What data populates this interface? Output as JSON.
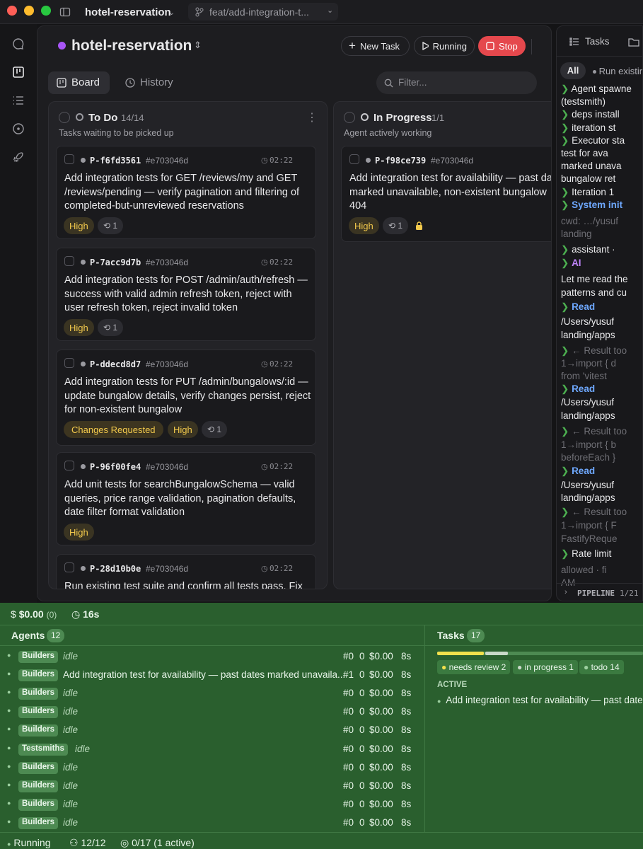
{
  "titlebar": {
    "project": "hotel-reservation",
    "branch": "feat/add-integration-t..."
  },
  "header": {
    "project_name": "hotel-reservation",
    "new_task": "New Task",
    "running": "Running",
    "stop": "Stop"
  },
  "tabs": {
    "board": "Board",
    "history": "History"
  },
  "filter": {
    "placeholder": "Filter..."
  },
  "columns": {
    "todo": {
      "title": "To Do",
      "count": "14/14",
      "subtitle": "Tasks waiting to be picked up"
    },
    "inprogress": {
      "title": "In Progress",
      "count": "1/1",
      "subtitle": "Agent actively working"
    }
  },
  "cards": [
    {
      "id": "P-f6fd3561",
      "hash": "#e703046d",
      "time": "02:22",
      "title": "Add integration tests for GET /reviews/my and GET /reviews/pending — verify pagination and filtering of completed-but-unreviewed reservations",
      "priority": "High",
      "retries": "1"
    },
    {
      "id": "P-7acc9d7b",
      "hash": "#e703046d",
      "time": "02:22",
      "title": "Add integration tests for POST /admin/auth/refresh — success with valid admin refresh token, reject with user refresh token, reject invalid token",
      "priority": "High",
      "retries": "1"
    },
    {
      "id": "P-ddecd8d7",
      "hash": "#e703046d",
      "time": "02:22",
      "title": "Add integration tests for PUT /admin/bungalows/:id — update bungalow details, verify changes persist, reject for non-existent bungalow",
      "status": "Changes Requested",
      "priority": "High",
      "retries": "1"
    },
    {
      "id": "P-96f00fe4",
      "hash": "#e703046d",
      "time": "02:22",
      "title": "Add unit tests for searchBungalowSchema — valid queries, price range validation, pagination defaults, date filter format validation",
      "priority": "High"
    },
    {
      "id": "P-28d10b0e",
      "hash": "#e703046d",
      "time": "02:22",
      "title": "Run existing test suite and confirm all tests pass. Fix"
    }
  ],
  "inprogress_card": {
    "id": "P-f98ce739",
    "hash": "#e703046d",
    "title": "Add integration test for availability — past da marked unavailable, non-existent bungalow 404",
    "priority": "High",
    "retries": "1"
  },
  "right_panel": {
    "tabs": {
      "tasks": "Tasks"
    },
    "filters": {
      "all": "All",
      "run_existing": "Run existin"
    },
    "log": [
      {
        "chev": "❯",
        "text": "Agent spawne"
      },
      {
        "chev": "",
        "text": "(testsmith)"
      },
      {
        "chev": "❯",
        "text": "deps install"
      },
      {
        "chev": "❯",
        "text": "iteration st"
      },
      {
        "chev": "❯",
        "text": "Executor sta"
      },
      {
        "chev": "",
        "text": "test for ava"
      },
      {
        "chev": "",
        "text": "marked unava"
      },
      {
        "chev": "",
        "text": "bungalow ret"
      },
      {
        "chev": "❯",
        "text": "Iteration 1"
      },
      {
        "chev": "❯",
        "text": "System init"
      }
    ],
    "log2": [
      {
        "cls": "log-dim",
        "text": "cwd: …/yusuf"
      },
      {
        "cls": "log-dim",
        "text": "landing"
      },
      {
        "cls": "",
        "text": "assistant ·"
      },
      {
        "cls": "ai",
        "text": "AI"
      },
      {
        "cls": "",
        "text": "Let me read the"
      },
      {
        "cls": "",
        "text": "patterns and cu"
      },
      {
        "cls": "read",
        "text": "Read"
      },
      {
        "cls": "",
        "text": "/Users/yusuf"
      },
      {
        "cls": "",
        "text": "landing/apps"
      },
      {
        "cls": "log-dim",
        "text": "← Result too"
      },
      {
        "cls": "log-dim",
        "text": "1→import { d"
      },
      {
        "cls": "log-dim",
        "text": "from 'vitest"
      },
      {
        "cls": "read",
        "text": "Read"
      },
      {
        "cls": "",
        "text": "/Users/yusuf"
      },
      {
        "cls": "",
        "text": "landing/apps"
      },
      {
        "cls": "log-dim",
        "text": "← Result too"
      },
      {
        "cls": "log-dim",
        "text": "1→import { b"
      },
      {
        "cls": "log-dim",
        "text": "beforeEach }"
      },
      {
        "cls": "read",
        "text": "Read"
      },
      {
        "cls": "",
        "text": "/Users/yusuf"
      },
      {
        "cls": "",
        "text": "landing/apps"
      },
      {
        "cls": "log-dim",
        "text": "← Result too"
      },
      {
        "cls": "log-dim",
        "text": "1→import { F"
      },
      {
        "cls": "log-dim",
        "text": "FastifyReque"
      },
      {
        "cls": "",
        "text": "Rate limit"
      },
      {
        "cls": "log-dim",
        "text": "allowed · fi"
      },
      {
        "cls": "log-dim",
        "text": "AM"
      }
    ],
    "pipeline": {
      "label": "PIPELINE",
      "count": "1/21"
    }
  },
  "stats": {
    "cost": "$0.00",
    "cost_count": "(0)",
    "time": "16s"
  },
  "agents": {
    "title": "Agents",
    "count": "12",
    "rows": [
      {
        "role": "Builders",
        "task": "idle",
        "idle": true,
        "num": "#0",
        "c": "0",
        "cost": "$0.00",
        "t": "8s"
      },
      {
        "role": "Builders",
        "task": "Add integration test for availability — past dates marked unavaila...",
        "idle": false,
        "num": "#1",
        "c": "0",
        "cost": "$0.00",
        "t": "8s"
      },
      {
        "role": "Builders",
        "task": "idle",
        "idle": true,
        "num": "#0",
        "c": "0",
        "cost": "$0.00",
        "t": "8s"
      },
      {
        "role": "Builders",
        "task": "idle",
        "idle": true,
        "num": "#0",
        "c": "0",
        "cost": "$0.00",
        "t": "8s"
      },
      {
        "role": "Builders",
        "task": "idle",
        "idle": true,
        "num": "#0",
        "c": "0",
        "cost": "$0.00",
        "t": "8s"
      },
      {
        "role": "Testsmiths",
        "task": "idle",
        "idle": true,
        "num": "#0",
        "c": "0",
        "cost": "$0.00",
        "t": "8s"
      },
      {
        "role": "Builders",
        "task": "idle",
        "idle": true,
        "num": "#0",
        "c": "0",
        "cost": "$0.00",
        "t": "8s"
      },
      {
        "role": "Builders",
        "task": "idle",
        "idle": true,
        "num": "#0",
        "c": "0",
        "cost": "$0.00",
        "t": "8s"
      },
      {
        "role": "Builders",
        "task": "idle",
        "idle": true,
        "num": "#0",
        "c": "0",
        "cost": "$0.00",
        "t": "8s"
      },
      {
        "role": "Builders",
        "task": "idle",
        "idle": true,
        "num": "#0",
        "c": "0",
        "cost": "$0.00",
        "t": "8s"
      }
    ]
  },
  "tasks_panel": {
    "title": "Tasks",
    "count": "17",
    "chips": {
      "needs_review": "needs review 2",
      "in_progress": "in progress 1",
      "todo": "todo 14"
    },
    "active_label": "ACTIVE",
    "active_task": "Add integration test for availability — past dates"
  },
  "statusbar": {
    "running": "Running",
    "agents": "12/12",
    "tasks": "0/17",
    "active": "(1 active)"
  },
  "colors": {
    "accent_red": "#e5484d",
    "high": "#f2c94c",
    "green_bg": "#2a5f2e",
    "log_blue": "#6ea8ff",
    "log_purple": "#c084fc"
  }
}
